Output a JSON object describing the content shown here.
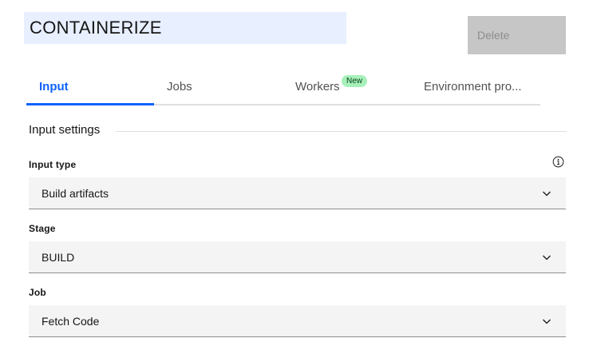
{
  "header": {
    "title": "CONTAINERIZE",
    "delete_label": "Delete"
  },
  "tabs": [
    {
      "label": "Input",
      "active": true
    },
    {
      "label": "Jobs",
      "active": false
    },
    {
      "label": "Workers",
      "badge": "New",
      "active": false
    },
    {
      "label": "Environment pro...",
      "active": false
    }
  ],
  "section": {
    "title": "Input settings"
  },
  "fields": [
    {
      "label": "Input type",
      "value": "Build artifacts",
      "has_info": true
    },
    {
      "label": "Stage",
      "value": "BUILD"
    },
    {
      "label": "Job",
      "value": "Fetch Code"
    }
  ],
  "colors": {
    "accent": "#0f62fe",
    "title_bg": "#e8efff",
    "badge_bg": "#a7f0ba",
    "disabled_bg": "#c6c6c6",
    "field_bg": "#f4f4f4"
  },
  "icons": {
    "info": "info-icon",
    "dropdown": "chevron-down-icon"
  }
}
